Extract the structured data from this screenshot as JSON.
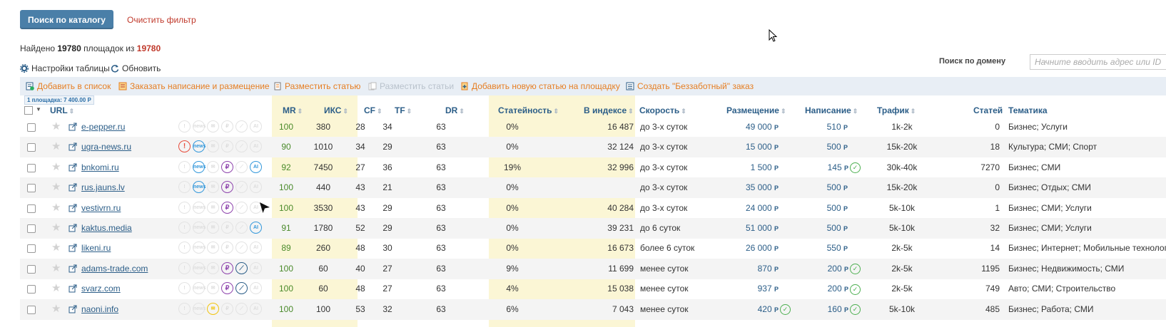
{
  "search_button": "Поиск по каталогу",
  "clear_filter": "Очистить фильтр",
  "found": {
    "prefix": "Найдено",
    "count": "19780",
    "middle": "площадок из",
    "total": "19780"
  },
  "table_settings": "Настройки таблицы",
  "refresh": "Обновить",
  "domain_search": {
    "label": "Поиск по домену",
    "placeholder": "Начните вводить адрес или ID"
  },
  "toolbar": {
    "add_to_list": "Добавить в список",
    "order_writing": "Заказать написание и размещение",
    "place_article": "Разместить статью",
    "place_articles": "Разместить статьи",
    "add_new_article": "Добавить новую статью на площадку",
    "create_order": "Создать \"Беззаботный\" заказ"
  },
  "selection_badge": "1 площадка: 7 400.00 Р",
  "columns": {
    "url": "URL",
    "mr": "MR",
    "iks": "ИКС",
    "cf": "CF",
    "tf": "TF",
    "dr": "DR",
    "article_rate": "Статейность",
    "in_index": "В индексе",
    "speed": "Скорость",
    "placement": "Размещение",
    "writing": "Написание",
    "traffic": "Трафик",
    "articles": "Статей",
    "topics": "Тематика"
  },
  "currency": "Р",
  "rows": [
    {
      "url": "e-pepper.ru",
      "mr": "100",
      "iks": "380",
      "cf": "28",
      "tf": "34",
      "dr": "63",
      "article_rate": "0%",
      "in_index": "16 487",
      "speed": "до 3-х суток",
      "placement": "49 000",
      "writing": "510",
      "traffic": "1k-2k",
      "articles": "0",
      "topics": "Бизнес; Услуги"
    },
    {
      "url": "ugra-news.ru",
      "mr": "90",
      "iks": "1010",
      "cf": "34",
      "tf": "29",
      "dr": "63",
      "article_rate": "0%",
      "in_index": "32 124",
      "speed": "до 3-х суток",
      "placement": "15 000",
      "writing": "500",
      "traffic": "15k-20k",
      "articles": "18",
      "topics": "Культура; СМИ; Спорт"
    },
    {
      "url": "bnkomi.ru",
      "mr": "92",
      "iks": "7450",
      "cf": "27",
      "tf": "36",
      "dr": "63",
      "article_rate": "19%",
      "in_index": "32 996",
      "speed": "до 3-х суток",
      "placement": "1 500",
      "writing": "145",
      "traffic": "30k-40k",
      "articles": "7270",
      "topics": "Бизнес; СМИ"
    },
    {
      "url": "rus.jauns.lv",
      "mr": "100",
      "iks": "440",
      "cf": "43",
      "tf": "21",
      "dr": "63",
      "article_rate": "0%",
      "in_index": "",
      "speed": "до 3-х суток",
      "placement": "35 000",
      "writing": "500",
      "traffic": "15k-20k",
      "articles": "0",
      "topics": "Бизнес; Отдых; СМИ"
    },
    {
      "url": "vestivrn.ru",
      "mr": "100",
      "iks": "3530",
      "cf": "43",
      "tf": "29",
      "dr": "63",
      "article_rate": "0%",
      "in_index": "40 284",
      "speed": "до 3-х суток",
      "placement": "24 000",
      "writing": "500",
      "traffic": "5k-10k",
      "articles": "1",
      "topics": "Бизнес; СМИ; Услуги"
    },
    {
      "url": "kaktus.media",
      "mr": "91",
      "iks": "1780",
      "cf": "52",
      "tf": "29",
      "dr": "63",
      "article_rate": "0%",
      "in_index": "39 231",
      "speed": "до 6 суток",
      "placement": "51 000",
      "writing": "500",
      "traffic": "5k-10k",
      "articles": "32",
      "topics": "Бизнес; СМИ; Услуги"
    },
    {
      "url": "likeni.ru",
      "mr": "89",
      "iks": "260",
      "cf": "48",
      "tf": "30",
      "dr": "63",
      "article_rate": "0%",
      "in_index": "16 673",
      "speed": "более 6 суток",
      "placement": "26 000",
      "writing": "550",
      "traffic": "2k-5k",
      "articles": "14",
      "topics": "Бизнес; Интернет; Мобильные технологии"
    },
    {
      "url": "adams-trade.com",
      "mr": "100",
      "iks": "60",
      "cf": "40",
      "tf": "27",
      "dr": "63",
      "article_rate": "9%",
      "in_index": "11 699",
      "speed": "менее суток",
      "placement": "870",
      "writing": "200",
      "traffic": "2k-5k",
      "articles": "1195",
      "topics": "Бизнес; Недвижимость; СМИ"
    },
    {
      "url": "svarz.com",
      "mr": "100",
      "iks": "60",
      "cf": "48",
      "tf": "27",
      "dr": "63",
      "article_rate": "4%",
      "in_index": "15 038",
      "speed": "менее суток",
      "placement": "937",
      "writing": "200",
      "traffic": "2k-5k",
      "articles": "749",
      "topics": "Авто; СМИ; Строительство"
    },
    {
      "url": "naoni.info",
      "mr": "100",
      "iks": "100",
      "cf": "53",
      "tf": "32",
      "dr": "63",
      "article_rate": "6%",
      "in_index": "7 043",
      "speed": "менее суток",
      "placement": "420",
      "writing": "160",
      "traffic": "5k-10k",
      "articles": "485",
      "topics": "Бизнес; Работа; СМИ"
    }
  ]
}
